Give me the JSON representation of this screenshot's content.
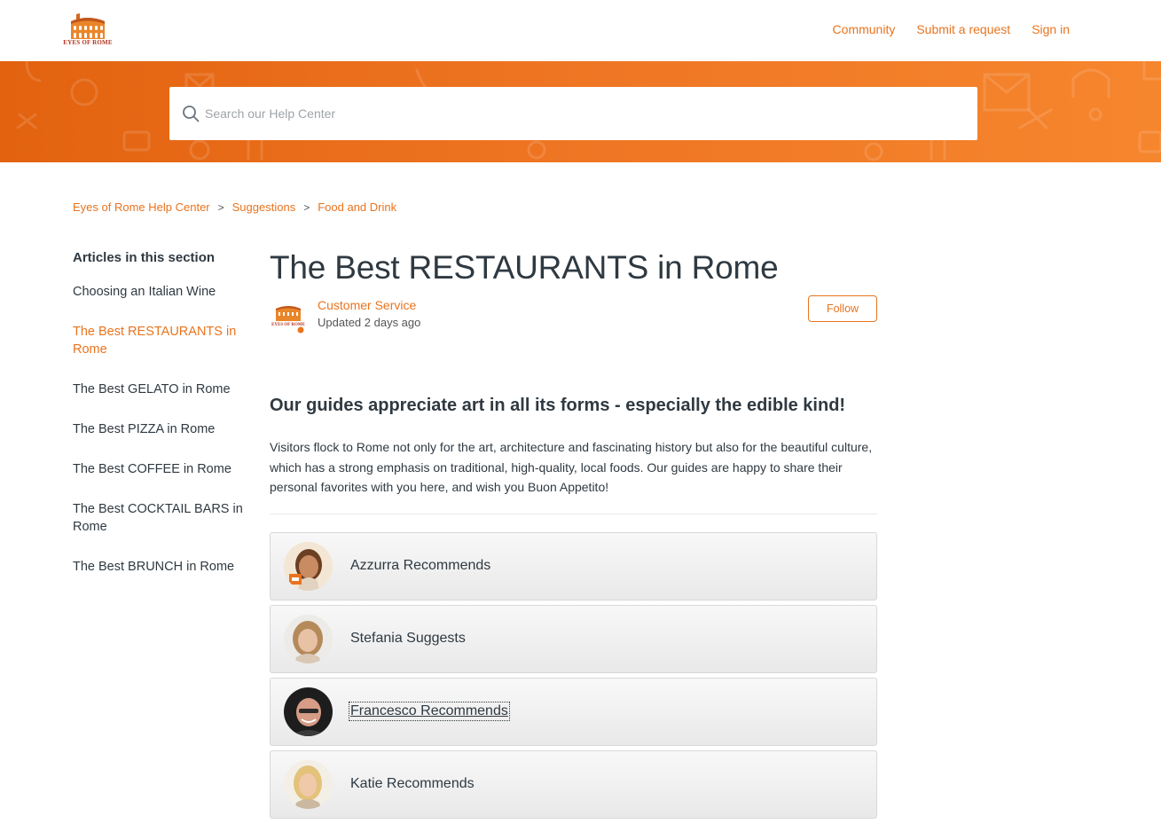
{
  "brand": {
    "name": "EYES OF ROME",
    "accent": "#e8741f"
  },
  "nav": {
    "community": "Community",
    "submit_request": "Submit a request",
    "sign_in": "Sign in"
  },
  "search": {
    "placeholder": "Search our Help Center",
    "value": ""
  },
  "breadcrumbs": [
    "Eyes of Rome Help Center",
    "Suggestions",
    "Food and Drink"
  ],
  "sidebar": {
    "heading": "Articles in this section",
    "items": [
      "Choosing an Italian Wine",
      "The Best RESTAURANTS in Rome",
      "The Best GELATO in Rome",
      "The Best PIZZA in Rome",
      "The Best COFFEE in Rome",
      "The Best COCKTAIL BARS in Rome",
      "The Best BRUNCH in Rome"
    ],
    "active_index": 1
  },
  "article": {
    "title": "The Best RESTAURANTS in Rome",
    "author": "Customer Service",
    "updated": "Updated 2 days ago",
    "follow_label": "Follow",
    "lead": "Our guides appreciate art in all its forms - especially the edible kind!",
    "body": "Visitors flock to Rome not only for the art, architecture and fascinating history but also for the beautiful culture, which has a strong emphasis on traditional, high-quality, local foods. Our guides are happy to share their personal favorites with you here, and wish you Buon Appetito!"
  },
  "cards": [
    {
      "title": "Azzurra Recommends"
    },
    {
      "title": "Stefania Suggests"
    },
    {
      "title": "Francesco Recommends"
    },
    {
      "title": "Katie Recommends"
    }
  ]
}
